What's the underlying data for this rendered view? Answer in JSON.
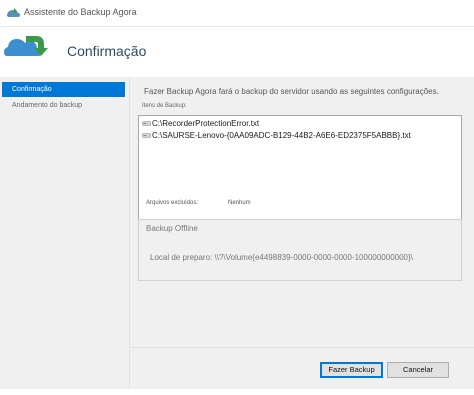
{
  "window": {
    "title": "Assistente do Backup Agora"
  },
  "header": {
    "heading": "Confirmação"
  },
  "nav": {
    "items": [
      {
        "label": "Confirmação",
        "active": true
      },
      {
        "label": "Andamento do backup",
        "active": false
      }
    ]
  },
  "confirmation": {
    "intro": "Fazer Backup Agora fará o backup do servidor usando as seguintes configurações.",
    "items_label": "Itens de Backup:",
    "items": [
      "C:\\RecorderProtectionError.txt",
      "C:\\SAURSE-Lenovo-{0AA09ADC-B129-44B2-A6E6-ED2375F5ABBB}.txt"
    ],
    "excluded_label": "Arquivos excluídos:",
    "excluded_value": "Nenhum"
  },
  "offline": {
    "title": "Backup Offline",
    "staging_location": "Local de preparo: \\\\?\\Volume{e4498839-0000-0000-0000-100000000000}\\"
  },
  "buttons": {
    "primary": "Fazer Backup",
    "cancel": "Cancelar"
  },
  "colors": {
    "accent": "#0078d7",
    "panel": "#f0f0f0",
    "heading": "#2b4a66"
  }
}
